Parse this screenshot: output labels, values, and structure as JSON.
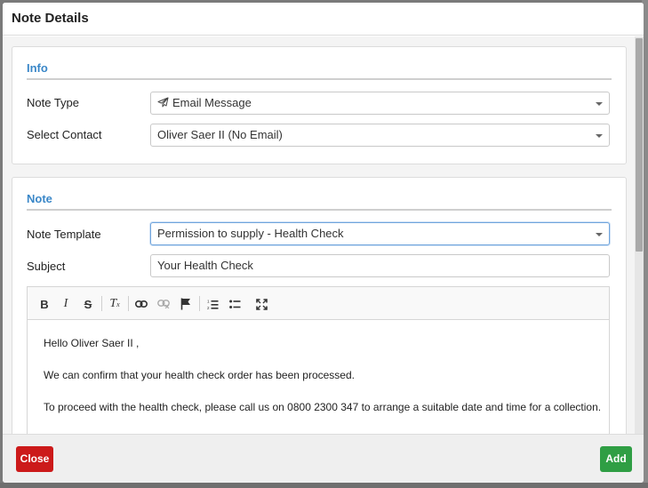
{
  "modal": {
    "title": "Note Details"
  },
  "info": {
    "title": "Info",
    "note_type_label": "Note Type",
    "note_type_value": "Email Message",
    "note_type_icon": "paper-plane-icon",
    "select_contact_label": "Select Contact",
    "select_contact_value": "Oliver Saer II (No Email)"
  },
  "note": {
    "title": "Note",
    "template_label": "Note Template",
    "template_value": "Permission to supply - Health Check",
    "subject_label": "Subject",
    "subject_value": "Your Health Check"
  },
  "toolbar": {
    "bold": "B",
    "italic": "I",
    "strike": "S",
    "clear_format": "T",
    "buttons": [
      "bold-icon",
      "italic-icon",
      "strikethrough-icon",
      "remove-format-icon",
      "link-icon",
      "unlink-icon",
      "flag-icon",
      "numbered-list-icon",
      "bulleted-list-icon",
      "maximize-icon"
    ]
  },
  "editor": {
    "line1": "Hello Oliver Saer II ,",
    "line2": "We can confirm that your health check order has been processed.",
    "line3": "To proceed with the health check, please call us on 0800 2300 347 to arrange a suitable date and time for a collection."
  },
  "footer": {
    "close_label": "Close",
    "add_label": "Add"
  },
  "colors": {
    "accent": "#3a87c8",
    "danger": "#cc1a1a",
    "success": "#2f9e44"
  }
}
